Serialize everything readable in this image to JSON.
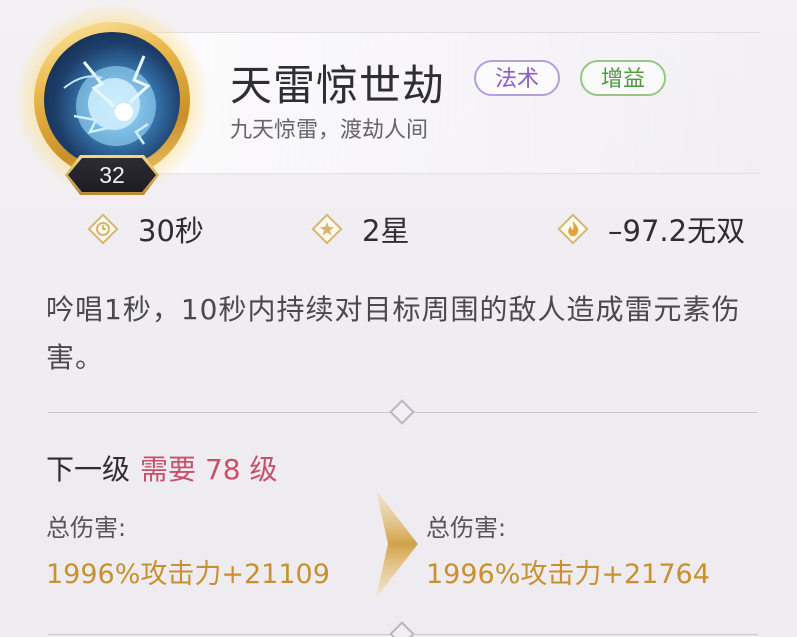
{
  "skill": {
    "name": "天雷惊世劫",
    "subtitle": "九天惊雷，渡劫人间",
    "level": "32",
    "tags": [
      {
        "label": "法术",
        "color": "#8a5fc6"
      },
      {
        "label": "增益",
        "color": "#4e9a3c"
      }
    ]
  },
  "stats": {
    "cooldown": {
      "icon": "clock-icon",
      "value": "30秒"
    },
    "stars": {
      "icon": "star-icon",
      "value": "2星"
    },
    "wushuang": {
      "icon": "flame-icon",
      "value": "–97.2无双"
    }
  },
  "description": "吟唱1秒，10秒内持续对目标周围的敌人造成雷元素伤害。",
  "next_level": {
    "title": "下一级",
    "requirement_prefix": "需要",
    "requirement_level": "78",
    "requirement_suffix": "级"
  },
  "comparison": {
    "current": {
      "label": "总伤害:",
      "value": "1996%攻击力+21109"
    },
    "next": {
      "label": "总伤害:",
      "value": "1996%攻击力+21764"
    }
  },
  "colors": {
    "accent_gold": "#c8902e",
    "requirement_red": "#c8506a"
  }
}
